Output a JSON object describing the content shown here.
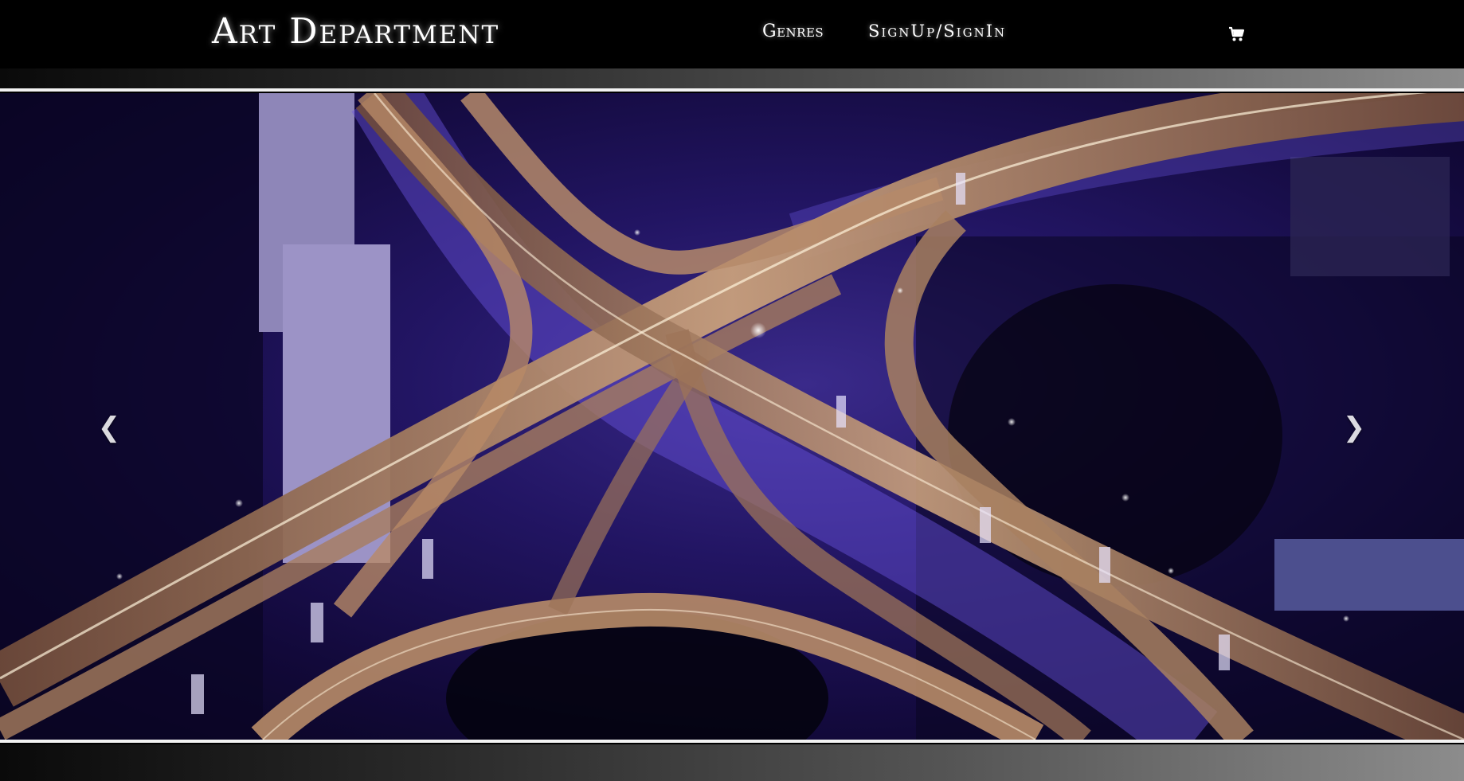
{
  "brand": {
    "title": "Art Department"
  },
  "nav": {
    "items": [
      {
        "label": "Genres"
      },
      {
        "label": "SignUp/SignIn"
      }
    ],
    "cart_icon": "shopping-cart-icon"
  },
  "carousel": {
    "image_icon": "highway-interchange-night-photo",
    "prev_icon": "chevron-left-icon",
    "next_icon": "chevron-right-icon",
    "slide_count": 5,
    "active_slide": 1
  },
  "colors": {
    "header_bg": "#000000",
    "text": "#ffffff",
    "photo_purple": "#3a2a8a",
    "road_glow": "#d8b48a"
  }
}
